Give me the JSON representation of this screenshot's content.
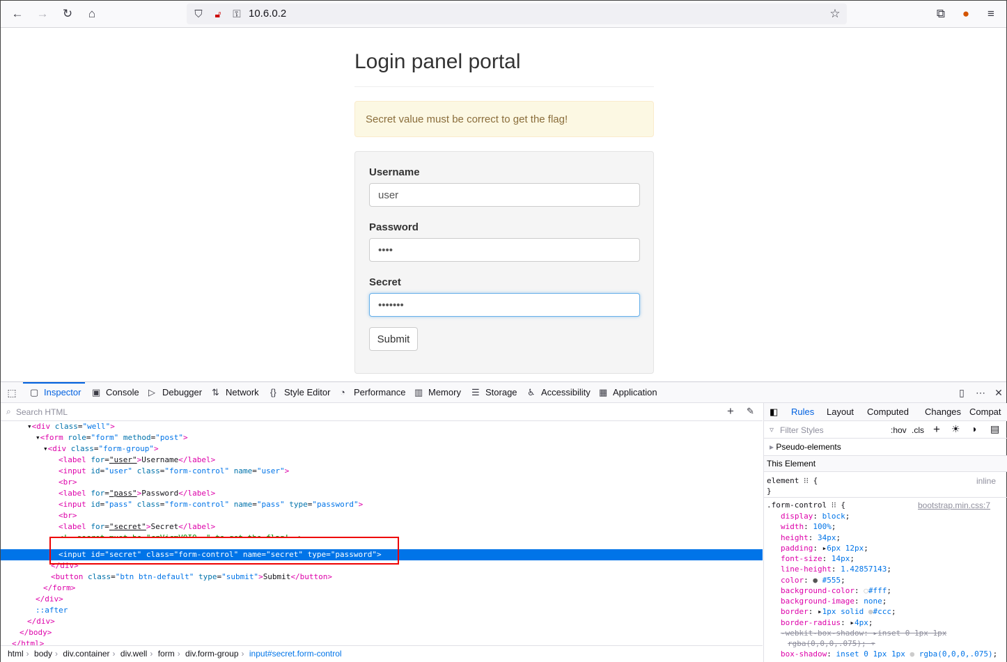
{
  "browser": {
    "url": "10.6.0.2"
  },
  "page": {
    "title": "Login panel portal",
    "alert": "Secret value must be correct to get the flag!",
    "username_label": "Username",
    "username_value": "user",
    "password_label": "Password",
    "password_value": "••••",
    "secret_label": "Secret",
    "secret_value": "•••••••",
    "submit_label": "Submit"
  },
  "devtools": {
    "tabs": [
      "Inspector",
      "Console",
      "Debugger",
      "Network",
      "Style Editor",
      "Performance",
      "Memory",
      "Storage",
      "Accessibility",
      "Application"
    ],
    "search_placeholder": "Search HTML",
    "breadcrumbs": [
      "html",
      "body",
      "div.container",
      "div.well",
      "form",
      "div.form-group",
      "input#secret.form-control"
    ],
    "rules_tabs": [
      "Rules",
      "Layout",
      "Computed",
      "Changes",
      "Compat"
    ],
    "filter_placeholder": "Filter Styles",
    "hov": ":hov",
    "cls": ".cls",
    "pseudo_elements": "Pseudo-elements",
    "this_element": "This Element",
    "element_rule": "element",
    "element_source": "inline",
    "form_control_selector": ".form-control",
    "form_control_source": "bootstrap.min.css:7",
    "comment_line": "<!--secret must be \"czVjcmV0IQ==\" to get the flag!-->"
  }
}
